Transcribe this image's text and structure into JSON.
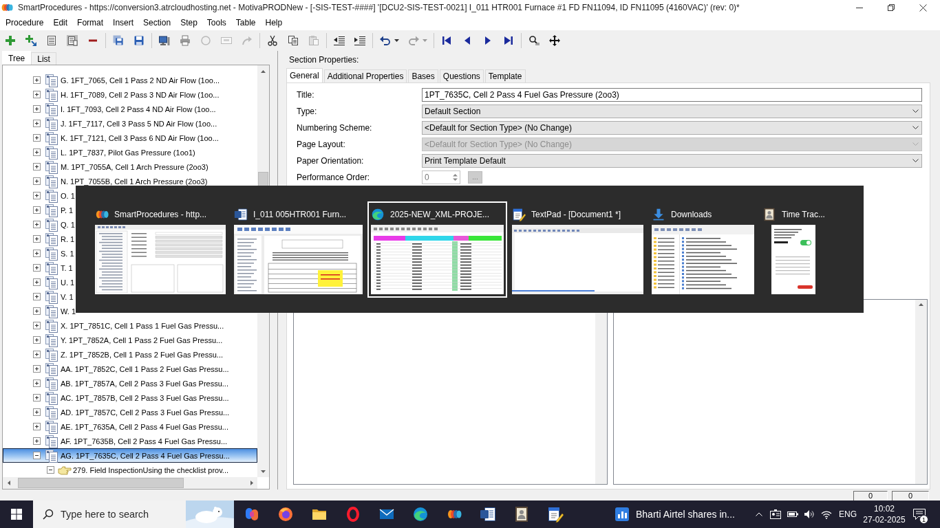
{
  "window": {
    "title": "SmartProcedures - https://conversion3.atrcloudhosting.net - MotivaPRODNew - [-SIS-TEST-####] '[DCU2-SIS-TEST-0021] I_011 HTR001 Furnace #1 FD FN11094, ID FN11095 (4160VAC)' (rev: 0)*"
  },
  "menu": [
    "Procedure",
    "Edit",
    "Format",
    "Insert",
    "Section",
    "Step",
    "Tools",
    "Table",
    "Help"
  ],
  "toolbar": [
    [
      {
        "disabled": false
      },
      {
        "disabled": false
      },
      {
        "disabled": false
      },
      {
        "disabled": false
      },
      {
        "disabled": false
      }
    ],
    [
      {
        "disabled": false
      },
      {
        "disabled": false
      }
    ],
    [
      {
        "disabled": false
      },
      {
        "disabled": false
      },
      {
        "disabled": true
      },
      {
        "disabled": true
      },
      {
        "disabled": true
      }
    ],
    [
      {
        "disabled": false
      },
      {
        "disabled": false
      },
      {
        "disabled": true
      }
    ],
    [
      {
        "disabled": false
      },
      {
        "disabled": false
      }
    ],
    [
      {
        "disabled": false
      },
      {
        "disabled": true
      }
    ],
    [
      {
        "disabled": false
      },
      {
        "disabled": false
      },
      {
        "disabled": false
      },
      {
        "disabled": false
      }
    ],
    [
      {
        "disabled": false
      },
      {
        "disabled": false
      }
    ]
  ],
  "navigator": {
    "tabs": [
      {
        "label": "Tree",
        "selected": true
      },
      {
        "label": "List",
        "selected": false
      }
    ],
    "tree": [
      {
        "label": "G. 1FT_7065, Cell 1 Pass 2 ND Air Flow (1oo...",
        "kind": "section",
        "expanded": false,
        "selected": false
      },
      {
        "label": "H. 1FT_7089, Cell 2 Pass 3 ND Air Flow (1oo...",
        "kind": "section",
        "expanded": false,
        "selected": false
      },
      {
        "label": "I. 1FT_7093, Cell 2 Pass 4 ND Air Flow (1oo...",
        "kind": "section",
        "expanded": false,
        "selected": false
      },
      {
        "label": "J. 1FT_7117, Cell 3 Pass 5 ND Air Flow (1oo...",
        "kind": "section",
        "expanded": false,
        "selected": false
      },
      {
        "label": "K. 1FT_7121, Cell 3 Pass 6 ND Air Flow (1oo...",
        "kind": "section",
        "expanded": false,
        "selected": false
      },
      {
        "label": "L. 1PT_7837, Pilot Gas Pressure (1oo1)",
        "kind": "section",
        "expanded": false,
        "selected": false
      },
      {
        "label": "M. 1PT_7055A, Cell 1 Arch Pressure (2oo3)",
        "kind": "section",
        "expanded": false,
        "selected": false
      },
      {
        "label": "N. 1PT_7055B, Cell 1 Arch Pressure (2oo3)",
        "kind": "section",
        "expanded": false,
        "selected": false
      },
      {
        "label": "O. 1",
        "kind": "section",
        "expanded": false,
        "selected": false
      },
      {
        "label": "P. 1",
        "kind": "section",
        "expanded": false,
        "selected": false
      },
      {
        "label": "Q. 1",
        "kind": "section",
        "expanded": false,
        "selected": false
      },
      {
        "label": "R. 1",
        "kind": "section",
        "expanded": false,
        "selected": false
      },
      {
        "label": "S. 1",
        "kind": "section",
        "expanded": false,
        "selected": false
      },
      {
        "label": "T. 1",
        "kind": "section",
        "expanded": false,
        "selected": false
      },
      {
        "label": "U. 1",
        "kind": "section",
        "expanded": false,
        "selected": false
      },
      {
        "label": "V. 1",
        "kind": "section",
        "expanded": false,
        "selected": false
      },
      {
        "label": "W. 1",
        "kind": "section",
        "expanded": false,
        "selected": false
      },
      {
        "label": "X. 1PT_7851C, Cell 1 Pass 1 Fuel Gas Pressu...",
        "kind": "section",
        "expanded": false,
        "selected": false
      },
      {
        "label": "Y. 1PT_7852A, Cell 1 Pass 2 Fuel Gas Pressu...",
        "kind": "section",
        "expanded": false,
        "selected": false
      },
      {
        "label": "Z. 1PT_7852B, Cell 1 Pass 2 Fuel Gas Pressu...",
        "kind": "section",
        "expanded": false,
        "selected": false
      },
      {
        "label": "AA. 1PT_7852C, Cell 1 Pass 2 Fuel Gas Pressu...",
        "kind": "section",
        "expanded": false,
        "selected": false
      },
      {
        "label": "AB. 1PT_7857A, Cell 2 Pass 3 Fuel Gas Pressu...",
        "kind": "section",
        "expanded": false,
        "selected": false
      },
      {
        "label": "AC. 1PT_7857B, Cell 2 Pass 3 Fuel Gas Pressu...",
        "kind": "section",
        "expanded": false,
        "selected": false
      },
      {
        "label": "AD. 1PT_7857C, Cell 2 Pass 3 Fuel Gas Pressu...",
        "kind": "section",
        "expanded": false,
        "selected": false
      },
      {
        "label": "AE. 1PT_7635A, Cell 2 Pass 4 Fuel Gas Pressu...",
        "kind": "section",
        "expanded": false,
        "selected": false
      },
      {
        "label": "AF. 1PT_7635B, Cell 2 Pass 4 Fuel Gas Pressu...",
        "kind": "section",
        "expanded": false,
        "selected": false
      },
      {
        "label": "AG. 1PT_7635C, Cell 2 Pass 4 Fuel Gas Pressu...",
        "kind": "section",
        "expanded": true,
        "selected": true,
        "children": [
          {
            "label": "279. Field InspectionUsing the checklist prov...",
            "kind": "step",
            "expanded": true,
            "selected": false
          }
        ]
      }
    ]
  },
  "section_properties": {
    "heading": "Section Properties:",
    "tabs": [
      {
        "label": "General",
        "selected": true
      },
      {
        "label": "Additional Properties",
        "selected": false
      },
      {
        "label": "Bases",
        "selected": false
      },
      {
        "label": "Questions",
        "selected": false
      },
      {
        "label": "Template",
        "selected": false
      }
    ],
    "fields": [
      {
        "label": "Title:",
        "kind": "text",
        "value": "1PT_7635C, Cell 2 Pass 4 Fuel Gas Pressure (2oo3)",
        "disabled": false
      },
      {
        "label": "Type:",
        "kind": "dropdown",
        "value": "Default Section",
        "disabled": false
      },
      {
        "label": "Numbering Scheme:",
        "kind": "dropdown",
        "value": "<Default for Section Type> (No Change)",
        "disabled": false
      },
      {
        "label": "Page Layout:",
        "kind": "dropdown",
        "value": "<Default for Section Type> (No Change)",
        "disabled": true
      },
      {
        "label": "Paper Orientation:",
        "kind": "dropdown",
        "value": "Print Template Default",
        "disabled": false
      },
      {
        "label": "Performance Order:",
        "kind": "spin",
        "value": "0",
        "disabled": true,
        "button": {
          "label": "...",
          "disabled": true
        }
      }
    ]
  },
  "status_bar": [
    "0",
    "0"
  ],
  "task_switcher": {
    "windows": [
      {
        "title": "SmartProcedures - http...",
        "selected": false
      },
      {
        "title": "I_011 005HTR001 Furn...",
        "selected": false
      },
      {
        "title": "2025-NEW_XML-PROJE...",
        "selected": true
      },
      {
        "title": "TextPad - [Document1 *]",
        "selected": false
      },
      {
        "title": "Downloads",
        "selected": false
      },
      {
        "title": "Time Trac...",
        "selected": false
      }
    ]
  },
  "taskbar": {
    "search": {
      "placeholder": "Type here to search"
    },
    "news": "Bharti Airtel shares in...",
    "language": "ENG",
    "time": "10:02",
    "date": "27-02-2025",
    "notifications": "1"
  }
}
